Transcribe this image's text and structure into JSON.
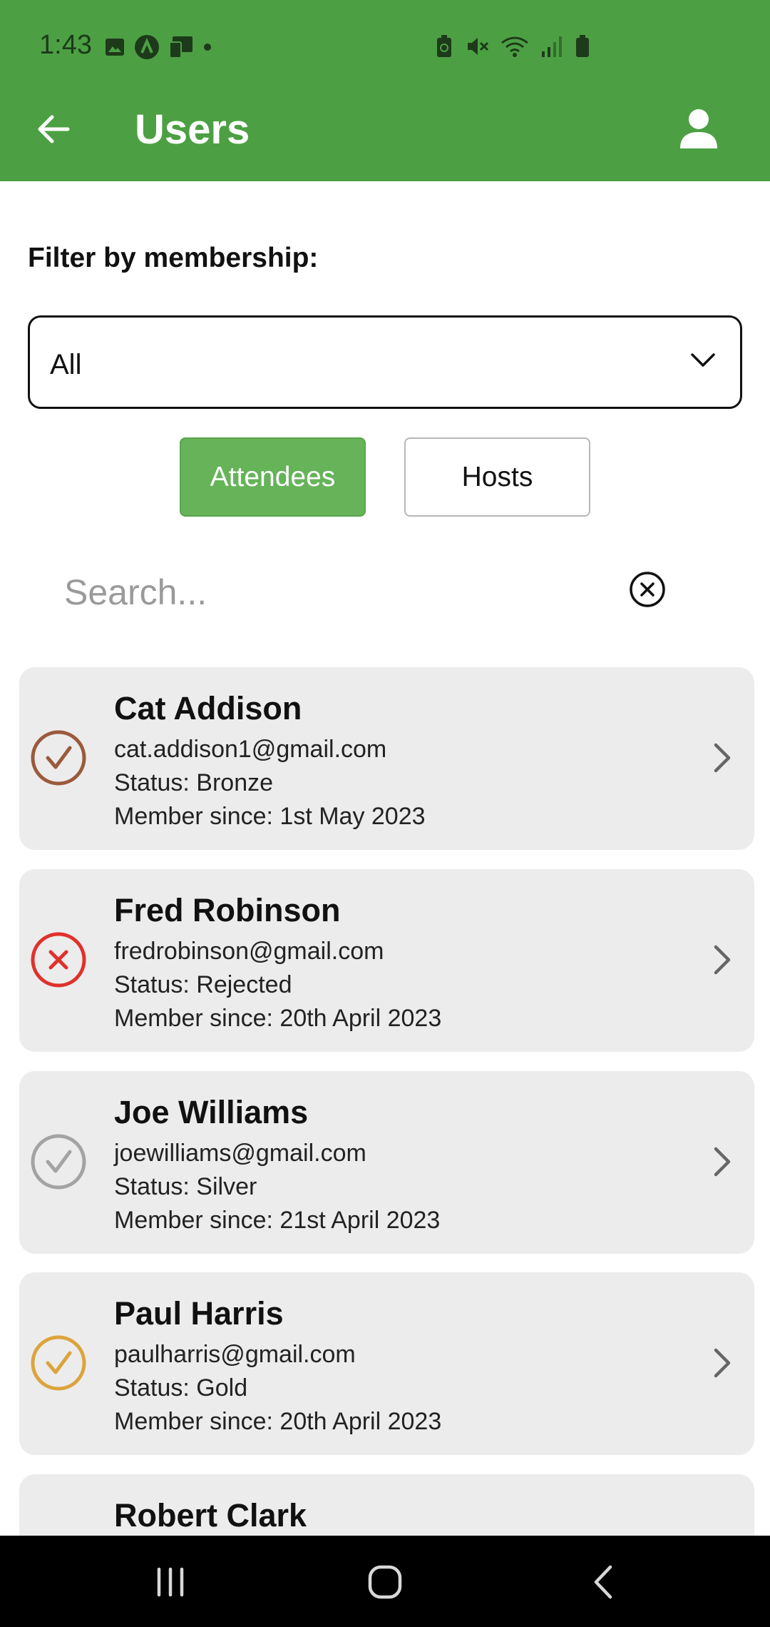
{
  "status_bar": {
    "time": "1:43"
  },
  "header": {
    "title": "Users"
  },
  "filter": {
    "label": "Filter by membership:",
    "selected": "All"
  },
  "segments": {
    "attendees": "Attendees",
    "hosts": "Hosts"
  },
  "search": {
    "placeholder": "Search..."
  },
  "users": [
    {
      "name": "Cat Addison",
      "email": "cat.addison1@gmail.com",
      "status": "Status: Bronze",
      "since": "Member since: 1st May 2023",
      "icon": "check-circle-icon",
      "color": "#9b5a3c"
    },
    {
      "name": "Fred Robinson",
      "email": "fredrobinson@gmail.com",
      "status": "Status: Rejected",
      "since": "Member since: 20th April 2023",
      "icon": "x-circle-icon",
      "color": "#e0312b"
    },
    {
      "name": "Joe Williams",
      "email": "joewilliams@gmail.com",
      "status": "Status: Silver",
      "since": "Member since: 21st April 2023",
      "icon": "check-circle-icon",
      "color": "#a3a3a3"
    },
    {
      "name": "Paul Harris",
      "email": "paulharris@gmail.com",
      "status": "Status: Gold",
      "since": "Member since: 20th April 2023",
      "icon": "check-circle-icon",
      "color": "#dba43c"
    },
    {
      "name": "Robert Clark",
      "email": "",
      "status": "",
      "since": "",
      "icon": "",
      "color": ""
    }
  ],
  "colors": {
    "app_bar": "#4ca043",
    "accent": "#66b35a",
    "card": "#ececec"
  }
}
